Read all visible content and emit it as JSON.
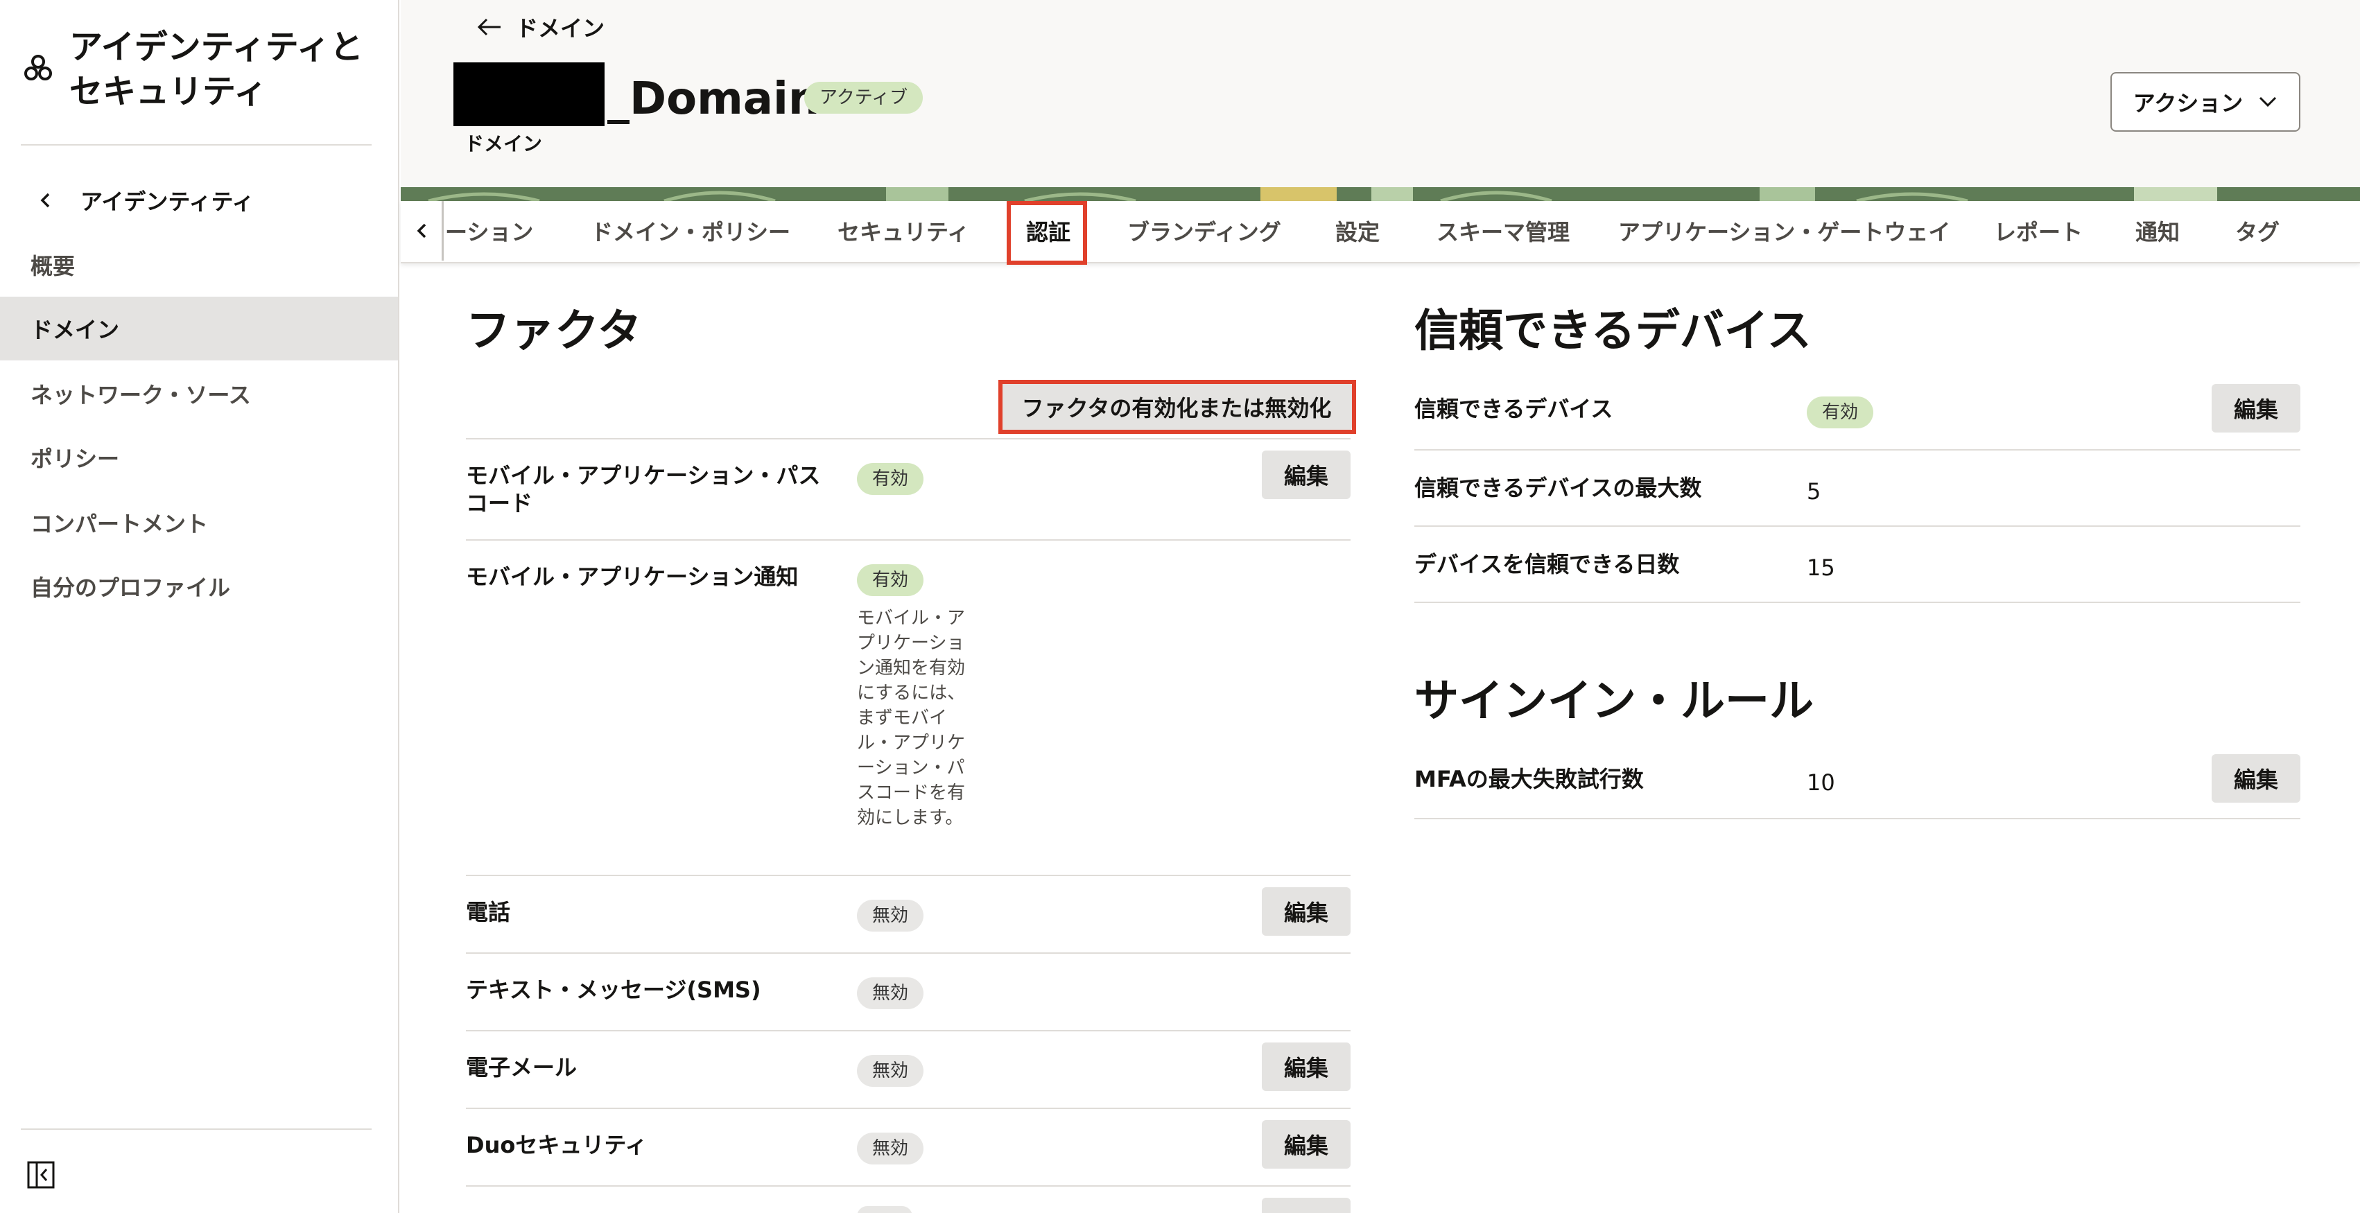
{
  "sidebar": {
    "title": "アイデンティティと セキュリティ",
    "back_label": "アイデンティティ",
    "items": [
      {
        "label": "概要",
        "active": false
      },
      {
        "label": "ドメイン",
        "active": true
      },
      {
        "label": "ネットワーク・ソース",
        "active": false
      },
      {
        "label": "ポリシー",
        "active": false
      },
      {
        "label": "コンパートメント",
        "active": false
      },
      {
        "label": "自分のプロファイル",
        "active": false
      }
    ]
  },
  "header": {
    "breadcrumb": "ドメイン",
    "domain_name": "_Domain",
    "status": "アクティブ",
    "subtitle": "ドメイン",
    "action_label": "アクション"
  },
  "tabs": [
    {
      "label": "ーション",
      "active": false
    },
    {
      "label": "ドメイン・ポリシー",
      "active": false
    },
    {
      "label": "セキュリティ",
      "active": false
    },
    {
      "label": "認証",
      "active": true
    },
    {
      "label": "ブランディング",
      "active": false
    },
    {
      "label": "設定",
      "active": false
    },
    {
      "label": "スキーマ管理",
      "active": false
    },
    {
      "label": "アプリケーション・ゲートウェイ",
      "active": false
    },
    {
      "label": "レポート",
      "active": false
    },
    {
      "label": "通知",
      "active": false
    },
    {
      "label": "タグ",
      "active": false
    }
  ],
  "factors": {
    "title": "ファクタ",
    "toggle_button": "ファクタの有効化または無効化",
    "edit_label": "編集",
    "rows": [
      {
        "name": "モバイル・アプリケーション・パス コード",
        "status": "有効"
      },
      {
        "name": "モバイル・アプリケーション通知",
        "status": "有効",
        "note": "モバイル・アプリケーション通知を有効にするには、まずモバイル・アプリケーション・パスコードを有効にします。"
      },
      {
        "name": "電話",
        "status": "無効"
      },
      {
        "name": "テキスト・メッセージ(SMS)",
        "status": "無効"
      },
      {
        "name": "電子メール",
        "status": "無効"
      },
      {
        "name": "Duoセキュリティ",
        "status": "無効"
      }
    ]
  },
  "trusted_devices": {
    "title": "信頼できるデバイス",
    "edit_label": "編集",
    "rows": [
      {
        "label": "信頼できるデバイス",
        "value": "有効"
      },
      {
        "label": "信頼できるデバイスの最大数",
        "value": "5"
      },
      {
        "label": "デバイスを信頼できる日数",
        "value": "15"
      }
    ]
  },
  "signin_rules": {
    "title": "サインイン・ルール",
    "edit_label": "編集",
    "rows": [
      {
        "label": "MFAの最大失敗試行数",
        "value": "10"
      }
    ]
  },
  "colors": {
    "highlight": "#e0402b",
    "enabled_badge": "#d4e7bf",
    "disabled_badge": "#e8e7e5",
    "active_sidebar": "#e4e3e1"
  }
}
